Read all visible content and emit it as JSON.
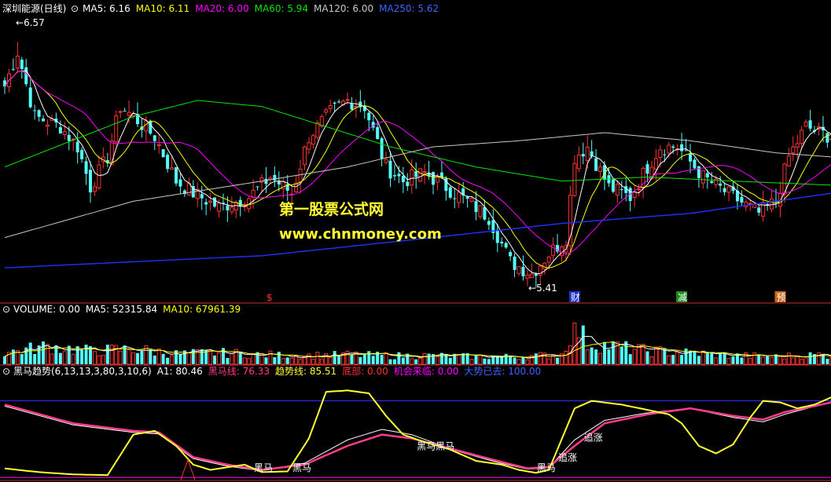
{
  "colors": {
    "bg": "#000000",
    "up": "#ff3232",
    "down": "#54fcfc",
    "ma5": "#ffffff",
    "ma10": "#ffff00",
    "ma20": "#ff00ff",
    "ma60": "#00e600",
    "ma120": "#c8c8c8",
    "ma250": "#1e32ff",
    "divider": "#c83232",
    "hm_line": "#ff3c8c",
    "trend_line": "#ffffff",
    "yellow_line": "#ffff32",
    "blue_line": "#3232ff"
  },
  "main": {
    "title": "深圳能源(日线)",
    "legend": [
      {
        "label": "MA5: 6.16",
        "color": "#ffffff"
      },
      {
        "label": "MA10: 6.11",
        "color": "#ffff00"
      },
      {
        "label": "MA20: 6.00",
        "color": "#ff00ff"
      },
      {
        "label": "MA60: 5.94",
        "color": "#00e600"
      },
      {
        "label": "MA120: 6.00",
        "color": "#c8c8c8"
      },
      {
        "label": "MA250: 5.62",
        "color": "#3c64ff"
      }
    ],
    "high_label": "6.57",
    "low_label": "5.41",
    "watermark_cn": "第一股票公式网",
    "watermark_url": "www.chnmoney.com",
    "markers": [
      {
        "label": "$",
        "color": "#ff3232",
        "bg": "",
        "x_index": 62
      },
      {
        "label": "财",
        "color": "#ffffff",
        "bg": "#1e32c8",
        "x_index": 133
      },
      {
        "label": "减",
        "color": "#ffffff",
        "bg": "#1e8c1e",
        "x_index": 158
      },
      {
        "label": "预",
        "color": "#ffffff",
        "bg": "#c86414",
        "x_index": 181
      }
    ]
  },
  "volume": {
    "legend": [
      {
        "label": "VOLUME: 0.00",
        "color": "#ffffff"
      },
      {
        "label": "MA5: 52315.84",
        "color": "#ffffff"
      },
      {
        "label": "MA10: 67961.39",
        "color": "#ffff00"
      }
    ]
  },
  "indicator": {
    "legend": [
      {
        "label": "黑马趋势(6,13,13,3,80,3,10,6)",
        "color": "#ffffff"
      },
      {
        "label": "A1: 80.46",
        "color": "#ffffff"
      },
      {
        "label": "黑马线: 76.33",
        "color": "#ff3c8c"
      },
      {
        "label": "趋势线: 85.51",
        "color": "#ffff32"
      },
      {
        "label": "底部: 0.00",
        "color": "#ff3232"
      },
      {
        "label": "机会来临: 0.00",
        "color": "#ff00ff"
      },
      {
        "label": "大势已去: 100.00",
        "color": "#3c64ff"
      }
    ],
    "annotations": [
      {
        "label": "黑马",
        "x_index": 60
      },
      {
        "label": "黑马",
        "x_index": 69
      },
      {
        "label": "黑马黑马",
        "x_index": 98
      },
      {
        "label": "黑马",
        "x_index": 126
      },
      {
        "label": "追涨",
        "x_index": 131
      },
      {
        "label": "追涨",
        "x_index": 137
      }
    ]
  },
  "chart_data": {
    "type": "candlestick",
    "ylim": [
      5.33,
      6.7
    ],
    "n_bars": 194,
    "high": 6.57,
    "low": 5.41,
    "price_anchors": [
      [
        0,
        6.35
      ],
      [
        3,
        6.52
      ],
      [
        7,
        6.2
      ],
      [
        13,
        6.15
      ],
      [
        17,
        6.05
      ],
      [
        20,
        5.85
      ],
      [
        24,
        6.0
      ],
      [
        27,
        6.25
      ],
      [
        30,
        6.2
      ],
      [
        35,
        6.1
      ],
      [
        40,
        5.88
      ],
      [
        44,
        5.82
      ],
      [
        50,
        5.75
      ],
      [
        57,
        5.8
      ],
      [
        62,
        5.9
      ],
      [
        67,
        5.82
      ],
      [
        71,
        6.1
      ],
      [
        76,
        6.22
      ],
      [
        80,
        6.28
      ],
      [
        84,
        6.25
      ],
      [
        89,
        5.95
      ],
      [
        93,
        5.88
      ],
      [
        98,
        5.92
      ],
      [
        103,
        5.85
      ],
      [
        108,
        5.78
      ],
      [
        113,
        5.7
      ],
      [
        118,
        5.48
      ],
      [
        123,
        5.42
      ],
      [
        127,
        5.52
      ],
      [
        131,
        5.6
      ],
      [
        133,
        6.0
      ],
      [
        136,
        6.05
      ],
      [
        141,
        5.85
      ],
      [
        146,
        5.8
      ],
      [
        150,
        5.95
      ],
      [
        153,
        6.05
      ],
      [
        157,
        6.05
      ],
      [
        163,
        5.9
      ],
      [
        170,
        5.8
      ],
      [
        176,
        5.72
      ],
      [
        180,
        5.78
      ],
      [
        183,
        6.0
      ],
      [
        187,
        6.15
      ],
      [
        190,
        6.12
      ],
      [
        193,
        6.1
      ]
    ],
    "volume_ylim": [
      0,
      250000
    ],
    "volume_anchors": [
      [
        0,
        60000
      ],
      [
        10,
        95000
      ],
      [
        20,
        70000
      ],
      [
        30,
        80000
      ],
      [
        40,
        55000
      ],
      [
        50,
        60000
      ],
      [
        60,
        50000
      ],
      [
        70,
        45000
      ],
      [
        80,
        50000
      ],
      [
        90,
        45000
      ],
      [
        100,
        45000
      ],
      [
        110,
        40000
      ],
      [
        120,
        40000
      ],
      [
        130,
        50000
      ],
      [
        133,
        215000
      ],
      [
        136,
        110000
      ],
      [
        140,
        100000
      ],
      [
        150,
        70000
      ],
      [
        160,
        60000
      ],
      [
        170,
        45000
      ],
      [
        180,
        40000
      ],
      [
        190,
        50000
      ],
      [
        193,
        45000
      ]
    ],
    "indicator_ylim": [
      -5,
      130
    ],
    "yellow_anchors": [
      [
        0,
        10
      ],
      [
        8,
        5
      ],
      [
        16,
        2
      ],
      [
        24,
        1
      ],
      [
        30,
        55
      ],
      [
        35,
        60
      ],
      [
        40,
        40
      ],
      [
        44,
        15
      ],
      [
        48,
        8
      ],
      [
        56,
        15
      ],
      [
        60,
        5
      ],
      [
        66,
        6
      ],
      [
        71,
        50
      ],
      [
        75,
        112
      ],
      [
        80,
        114
      ],
      [
        85,
        110
      ],
      [
        89,
        80
      ],
      [
        93,
        55
      ],
      [
        98,
        45
      ],
      [
        104,
        35
      ],
      [
        110,
        20
      ],
      [
        116,
        15
      ],
      [
        120,
        8
      ],
      [
        124,
        4
      ],
      [
        127,
        8
      ],
      [
        133,
        90
      ],
      [
        137,
        100
      ],
      [
        144,
        95
      ],
      [
        150,
        88
      ],
      [
        155,
        82
      ],
      [
        158,
        70
      ],
      [
        162,
        40
      ],
      [
        166,
        30
      ],
      [
        170,
        42
      ],
      [
        174,
        78
      ],
      [
        177,
        100
      ],
      [
        181,
        98
      ],
      [
        185,
        90
      ],
      [
        189,
        95
      ],
      [
        193,
        105
      ]
    ],
    "hm_anchors": [
      [
        0,
        95
      ],
      [
        16,
        70
      ],
      [
        30,
        60
      ],
      [
        36,
        58
      ],
      [
        44,
        25
      ],
      [
        52,
        15
      ],
      [
        60,
        8
      ],
      [
        70,
        15
      ],
      [
        80,
        40
      ],
      [
        88,
        55
      ],
      [
        95,
        50
      ],
      [
        105,
        35
      ],
      [
        115,
        20
      ],
      [
        122,
        10
      ],
      [
        127,
        12
      ],
      [
        133,
        40
      ],
      [
        140,
        70
      ],
      [
        150,
        82
      ],
      [
        160,
        90
      ],
      [
        170,
        80
      ],
      [
        177,
        75
      ],
      [
        182,
        85
      ],
      [
        193,
        98
      ]
    ],
    "trend_anchors": [
      [
        0,
        93
      ],
      [
        16,
        68
      ],
      [
        30,
        58
      ],
      [
        36,
        56
      ],
      [
        44,
        23
      ],
      [
        52,
        13
      ],
      [
        60,
        7
      ],
      [
        70,
        17
      ],
      [
        80,
        48
      ],
      [
        88,
        62
      ],
      [
        95,
        55
      ],
      [
        105,
        34
      ],
      [
        115,
        18
      ],
      [
        122,
        9
      ],
      [
        127,
        11
      ],
      [
        133,
        48
      ],
      [
        140,
        74
      ],
      [
        150,
        84
      ],
      [
        160,
        90
      ],
      [
        170,
        78
      ],
      [
        177,
        72
      ],
      [
        182,
        82
      ],
      [
        193,
        99
      ]
    ],
    "top_level": 100,
    "bottom_level": 0
  }
}
